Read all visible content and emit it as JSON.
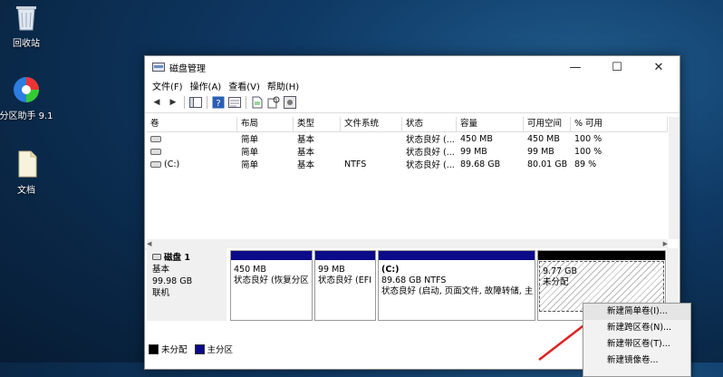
{
  "desktop": {
    "icons": [
      {
        "label": "回收站",
        "icon": "recycle-bin-icon"
      },
      {
        "label": "分区助手 9.1",
        "icon": "partition-assistant-icon"
      },
      {
        "label": "文档",
        "icon": "document-icon"
      }
    ]
  },
  "window": {
    "title": "磁盘管理",
    "controls": {
      "minimize": "—",
      "maximize": "☐",
      "close": "✕"
    },
    "menu": [
      "文件(F)",
      "操作(A)",
      "查看(V)",
      "帮助(H)"
    ],
    "toolbar": {
      "back": "◀",
      "forward": "▶"
    }
  },
  "volumes": {
    "headers": [
      "卷",
      "布局",
      "类型",
      "文件系统",
      "状态",
      "容量",
      "可用空间",
      "% 可用"
    ],
    "rows": [
      {
        "vol": "",
        "layout": "简单",
        "type": "基本",
        "fs": "",
        "status": "状态良好 (...",
        "capacity": "450 MB",
        "free": "450 MB",
        "pct": "100 %"
      },
      {
        "vol": "",
        "layout": "简单",
        "type": "基本",
        "fs": "",
        "status": "状态良好 (...",
        "capacity": "99 MB",
        "free": "99 MB",
        "pct": "100 %"
      },
      {
        "vol": "(C:)",
        "layout": "简单",
        "type": "基本",
        "fs": "NTFS",
        "status": "状态良好 (...",
        "capacity": "89.68 GB",
        "free": "80.01 GB",
        "pct": "89 %"
      }
    ]
  },
  "disk": {
    "name": "磁盘 1",
    "type": "基本",
    "size": "99.98 GB",
    "state": "联机",
    "partitions": [
      {
        "line1": "",
        "line2": "450 MB",
        "line3": "状态良好 (恢复分区"
      },
      {
        "line1": "",
        "line2": "99 MB",
        "line3": "状态良好 (EFI"
      },
      {
        "line1": "(C:)",
        "line2": "89.68 GB NTFS",
        "line3": "状态良好 (启动, 页面文件, 故障转储, 主"
      },
      {
        "line1": "",
        "line2": "9.77 GB",
        "line3": "未分配"
      }
    ]
  },
  "legend": [
    {
      "label": "未分配",
      "color": "#000000"
    },
    {
      "label": "主分区",
      "color": "#0b0b8a"
    }
  ],
  "context_menu": {
    "items": [
      "新建简单卷(I)...",
      "新建跨区卷(N)...",
      "新建带区卷(T)...",
      "新建镜像卷..."
    ]
  }
}
